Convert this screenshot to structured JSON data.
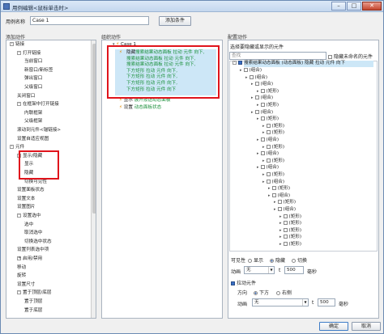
{
  "window": {
    "title": "用例编辑<鼠标单击时>",
    "min": "–",
    "max": "□",
    "close": "✕"
  },
  "top": {
    "case_name_label": "用例名称",
    "case_name_value": "Case 1",
    "add_condition": "添加条件"
  },
  "sections": {
    "add_action": "添加动作",
    "org_action": "组织动作",
    "config_action": "配置动作"
  },
  "left_tree": [
    {
      "text": "链接",
      "indent": 0,
      "expander": "-"
    },
    {
      "text": "打开链接",
      "indent": 1,
      "expander": "-"
    },
    {
      "text": "当前窗口",
      "indent": 2
    },
    {
      "text": "新窗口/新标签",
      "indent": 2
    },
    {
      "text": "弹出窗口",
      "indent": 2
    },
    {
      "text": "父级窗口",
      "indent": 2
    },
    {
      "text": "关闭窗口",
      "indent": 1
    },
    {
      "text": "在框架中打开链接",
      "indent": 1,
      "expander": "-"
    },
    {
      "text": "内联框架",
      "indent": 2
    },
    {
      "text": "父级框架",
      "indent": 2
    },
    {
      "text": "滚动到元件<锚链接>",
      "indent": 1
    },
    {
      "text": "设置自适应视图",
      "indent": 1
    },
    {
      "text": "元件",
      "indent": 0,
      "expander": "-"
    },
    {
      "text": "显示/隐藏",
      "indent": 1,
      "expander": "-"
    },
    {
      "text": "显示",
      "indent": 2
    },
    {
      "text": "隐藏",
      "indent": 2
    },
    {
      "text": "切换可见性",
      "indent": 2
    },
    {
      "text": "设置面板状态",
      "indent": 1
    },
    {
      "text": "设置文本",
      "indent": 1
    },
    {
      "text": "设置图片",
      "indent": 1
    },
    {
      "text": "设置选中",
      "indent": 1,
      "expander": "-"
    },
    {
      "text": "选中",
      "indent": 2
    },
    {
      "text": "取消选中",
      "indent": 2
    },
    {
      "text": "切换选中状态",
      "indent": 2
    },
    {
      "text": "设置列表选中项",
      "indent": 1
    },
    {
      "text": "启用/禁用",
      "indent": 1,
      "expander": "+"
    },
    {
      "text": "移动",
      "indent": 1
    },
    {
      "text": "旋转",
      "indent": 1
    },
    {
      "text": "设置尺寸",
      "indent": 1
    },
    {
      "text": "置于顶层/底层",
      "indent": 1,
      "expander": "-"
    },
    {
      "text": "置于顶层",
      "indent": 2
    },
    {
      "text": "置于底层",
      "indent": 2
    }
  ],
  "org": {
    "case_label": "Case 1",
    "hide_verb": "隐藏",
    "hide_lines": [
      "搜索结果动态面板 拉动 元件 向下,",
      "搜索结果动态面板 拉动 元件 向下,",
      "搜索结果动态面板 拉动 元件 向下,",
      "下方矩形 拉动 元件 向下,",
      "下方矩形 拉动 元件 向下,",
      "下方矩形 拉动 元件 向下,",
      "下方矩形 拉动 元件 向下"
    ],
    "show_verb": "显示",
    "show_detail": "展开按钮动态面板",
    "set_verb": "设置",
    "set_detail": "动态面板状态"
  },
  "config": {
    "choose_label": "选择要隐藏或显示的元件",
    "filter_placeholder": "查找",
    "hide_unnamed": "隐藏未命名的元件",
    "selected_row": "搜索结果动态面板 (动态面板) 隐藏 拉动 元件 向下",
    "tree": [
      {
        "text": "(组合)",
        "indent": 1
      },
      {
        "text": "(组合)",
        "indent": 2
      },
      {
        "text": "(组合)",
        "indent": 3
      },
      {
        "text": "(矩形)",
        "indent": 4
      },
      {
        "text": "(组合)",
        "indent": 3
      },
      {
        "text": "(矩形)",
        "indent": 4
      },
      {
        "text": "(组合)",
        "indent": 3
      },
      {
        "text": "(矩形)",
        "indent": 4
      },
      {
        "text": "(矩形)",
        "indent": 5
      },
      {
        "text": "(矩形)",
        "indent": 5
      },
      {
        "text": "(组合)",
        "indent": 4
      },
      {
        "text": "(矩形)",
        "indent": 5
      },
      {
        "text": "(组合)",
        "indent": 4
      },
      {
        "text": "(矩形)",
        "indent": 5
      },
      {
        "text": "(组合)",
        "indent": 4
      },
      {
        "text": "(矩形)",
        "indent": 5
      },
      {
        "text": "(组合)",
        "indent": 5
      },
      {
        "text": "(矩形)",
        "indent": 6
      },
      {
        "text": "(组合)",
        "indent": 6
      },
      {
        "text": "(矩形)",
        "indent": 7
      },
      {
        "text": "(组合)",
        "indent": 7
      },
      {
        "text": "(矩形)",
        "indent": 8
      },
      {
        "text": "(矩形)",
        "indent": 8
      },
      {
        "text": "(矩形)",
        "indent": 8
      },
      {
        "text": "(矩形)",
        "indent": 8
      },
      {
        "text": "(矩形)",
        "indent": 8
      }
    ],
    "visibility_label": "可见性",
    "opt_show": "显示",
    "opt_hide": "隐藏",
    "opt_toggle": "切换",
    "anim_label": "动画",
    "anim_value": "无",
    "t_label": "t",
    "t_value": "500",
    "ms": "毫秒",
    "pull_label": "拉动元件",
    "dir_label": "方向",
    "dir_down": "下方",
    "dir_right": "右侧",
    "anim2_label": "动画",
    "anim2_value": "无",
    "t2_label": "t",
    "t2_value": "500",
    "ms2": "毫秒"
  },
  "footer": {
    "ok": "确定",
    "cancel": "取消"
  }
}
